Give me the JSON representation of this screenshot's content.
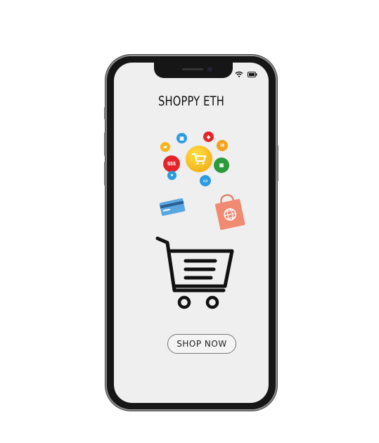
{
  "app": {
    "title": "SHOPPY ETH",
    "primary_button_label": "SHOP NOW"
  },
  "status_bar": {
    "icons": [
      "wifi-icon",
      "battery-icon"
    ]
  },
  "illustration": {
    "icons": [
      "shopping-cart-icon",
      "price-tag-icon",
      "mail-icon",
      "truck-icon",
      "money-icon",
      "calendar-icon",
      "shopping-bag-icon",
      "globe-bag-icon",
      "credit-card-icon",
      "monitor-icon",
      "location-icon"
    ],
    "bubble_text": {
      "money": "$$$"
    }
  },
  "colors": {
    "screen_background": "#efefef",
    "phone_frame": "#161616",
    "bag_color": "#f08a72",
    "card_color": "#5aa7e0",
    "cart_stroke": "#111111"
  }
}
